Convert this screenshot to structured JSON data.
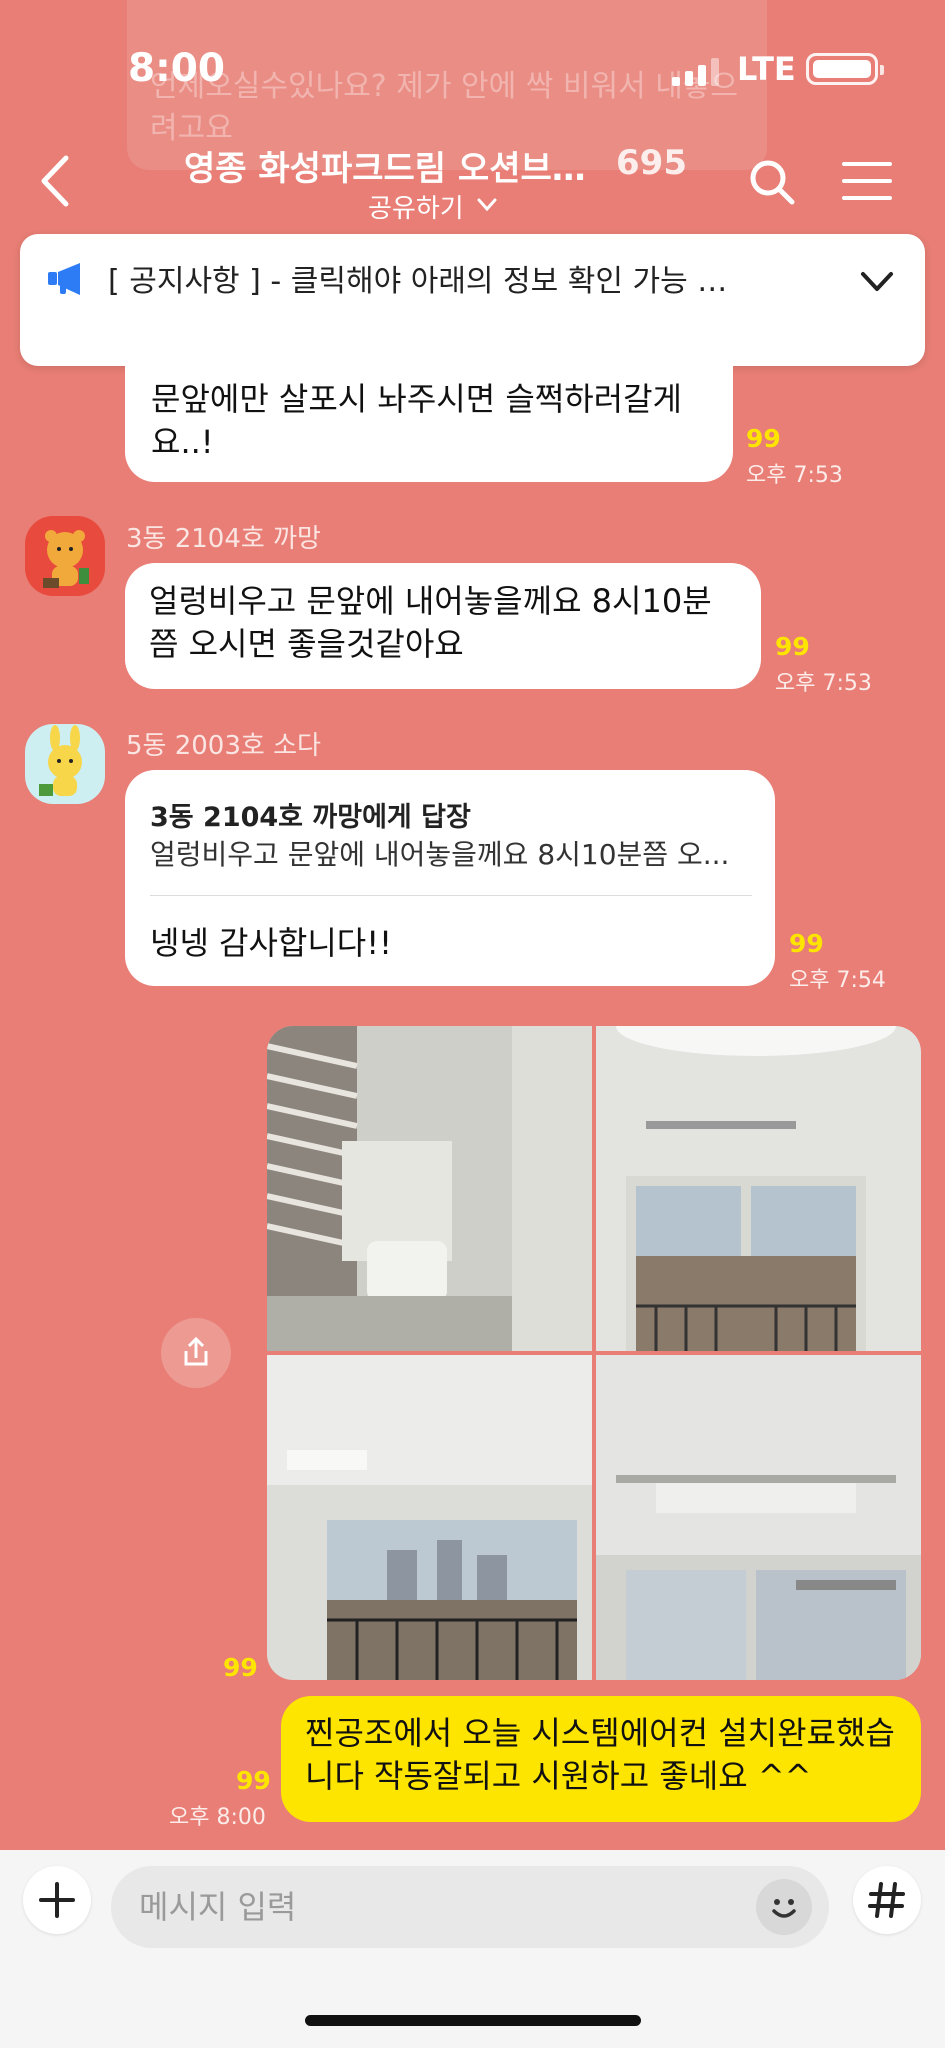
{
  "status_bar": {
    "time": "8:00",
    "network": "LTE"
  },
  "background_preview": {
    "text": "언제오실수있나요? 제가 안에 싹 비워서 내놓으려고요"
  },
  "header": {
    "title": "영종 화성파크드림 오션브…",
    "member_count": "695",
    "subtitle": "공유하기"
  },
  "notice": {
    "text": "[ 공지사항 ] - 클릭해야 아래의 정보 확인 가능 …"
  },
  "messages": [
    {
      "text": "문앞에만 살포시 놔주시면 슬쩍하러갈게요..!",
      "read_count": "99",
      "time": "오후 7:53"
    },
    {
      "sender": "3동 2104호 까망",
      "text": "얼렁비우고 문앞에 내어놓을께요 8시10분쯤 오시면 좋을것같아요",
      "read_count": "99",
      "time": "오후 7:53"
    },
    {
      "sender": "5동 2003호 소다",
      "reply_to": "3동 2104호 까망에게 답장",
      "reply_quote": "얼렁비우고 문앞에 내어놓을께요 8시10분쯤 오...",
      "text": "넹넹 감사합니다!!",
      "read_count": "99",
      "time": "오후 7:54"
    },
    {
      "type": "photos",
      "read_count": "99"
    },
    {
      "text": "찐공조에서 오늘 시스템에어컨 설치완료했습니다 작동잘되고 시원하고 좋네요 ^^",
      "read_count": "99",
      "time": "오후 8:00"
    }
  ],
  "input": {
    "placeholder": "메시지 입력"
  },
  "colors": {
    "background": "#E87E75",
    "my_bubble": "#FEE500",
    "read_count": "#FEE500",
    "notice_icon": "#2D7CF6"
  }
}
